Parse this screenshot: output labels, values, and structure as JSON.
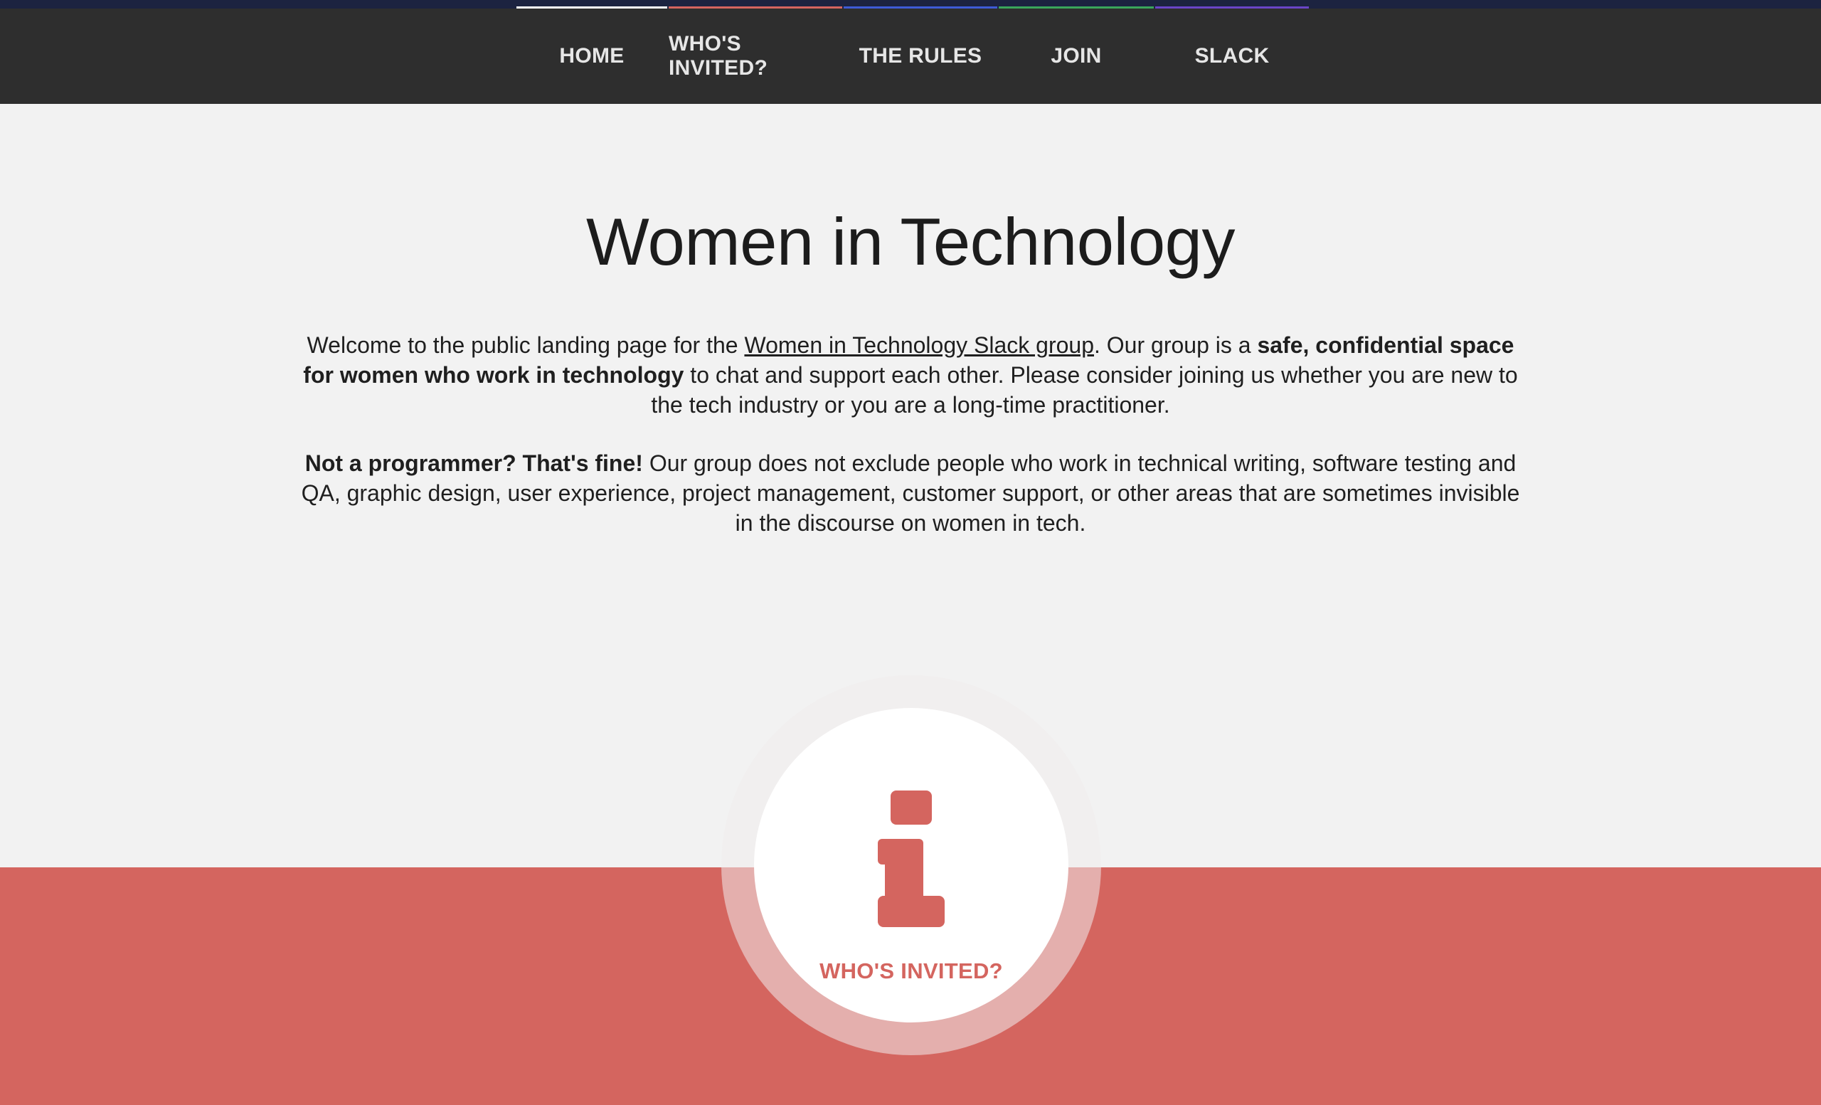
{
  "nav": {
    "items": [
      {
        "label": "HOME",
        "accent": "#ffffff"
      },
      {
        "label": "WHO'S INVITED?",
        "accent": "#d4655f"
      },
      {
        "label": "THE RULES",
        "accent": "#3e5bd6"
      },
      {
        "label": "JOIN",
        "accent": "#3aa65a"
      },
      {
        "label": "SLACK",
        "accent": "#6a45c8"
      }
    ]
  },
  "main": {
    "title": "Women in Technology",
    "intro": {
      "t1": "Welcome to the public landing page for the ",
      "link": "Women in Technology Slack group",
      "t2": ". Our group is a ",
      "bold": "safe, confidential space for women who work in technology",
      "t3": " to chat and support each other. Please consider joining us whether you are new to the tech industry or you are a long-time practitioner."
    },
    "secondary": {
      "bold": "Not a programmer? That's fine!",
      "text": " Our group does not exclude people who work in technical writing, software testing and QA, graphic design, user experience, project management, customer support, or other areas that are sometimes invisible in the discourse on women in tech."
    }
  },
  "section_badge": {
    "icon": "info-icon",
    "label": "WHO'S INVITED?"
  },
  "colors": {
    "accent_red": "#d4655f",
    "navbar": "#2e2e2e",
    "background": "#f2f2f2"
  }
}
